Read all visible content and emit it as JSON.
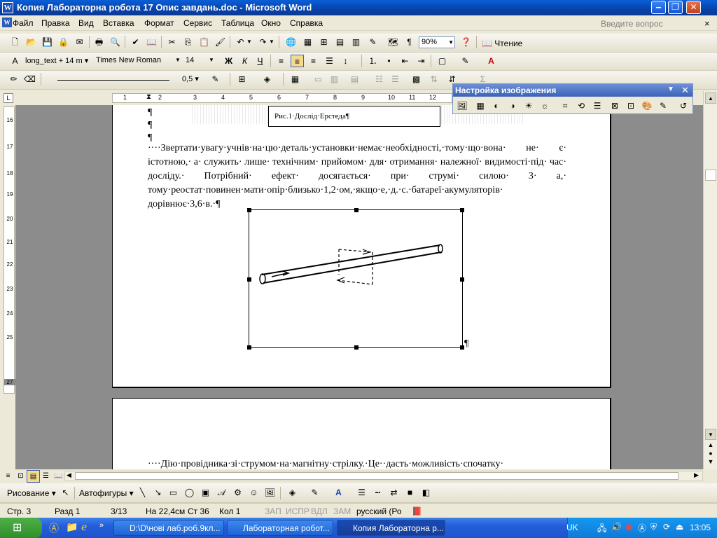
{
  "window": {
    "title": "Копия Лабораторна робота 17 Опис завдань.doc - Microsoft Word",
    "controls": [
      "minimize",
      "restore",
      "close"
    ]
  },
  "menu": {
    "items": [
      "Файл",
      "Правка",
      "Вид",
      "Вставка",
      "Формат",
      "Сервис",
      "Таблица",
      "Окно",
      "Справка"
    ],
    "ask_placeholder": "Введите вопрос"
  },
  "toolbar_standard": {
    "zoom": "90%",
    "reading_label": "Чтение"
  },
  "toolbar_formatting": {
    "style": "long_text + 14 m",
    "font": "Times New Roman",
    "size": "14"
  },
  "toolbar_tables": {
    "line_weight": "0,5"
  },
  "picture_toolbar": {
    "title": "Настройка изображения"
  },
  "document": {
    "caption": "Рис.1·Дослід·Ерстеда¶",
    "pilcrows": [
      "¶",
      "¶",
      "¶"
    ],
    "paragraph1": "····Звертати·увагу·учнів·на·цю·деталь·установки·немає·необхідності,·тому·що·вона· не· є· істотною,· а· служить· лише· технічним· прийомом· для· отримання· належної· видимості·під· час· досліду.· Потрібний· ефект· досягається· при· струмі· силою· 3· а,· тому·реостат·повинен·мати·опір·близько·1,2·ом,·якщо·е,·д.·с.·батареї·акумуляторів· дорівнює·3,6·в.·¶",
    "figure_mark": "¶",
    "page2_text": "····Дію·провідника·зі·струмом·на·магнітну·стрілку.·Це··дасть·можливість·спочатку·"
  },
  "hruler_numbers": [
    "1",
    "2",
    "3",
    "4",
    "5",
    "6",
    "7",
    "8",
    "9",
    "10",
    "11",
    "12"
  ],
  "vruler_numbers": [
    "16",
    "17",
    "18",
    "19",
    "20",
    "21",
    "22",
    "23",
    "24",
    "25",
    "27"
  ],
  "drawing_toolbar": {
    "draw_label": "Рисование",
    "autoshapes_label": "Автофигуры"
  },
  "status": {
    "page": "Стр.  3",
    "section": "Разд  1",
    "pages": "3/13",
    "position": "На 22,4см",
    "line": "Ст  36",
    "column": "Кол  1",
    "rec": "ЗАП",
    "trk": "ИСПР",
    "ext": "ВДЛ",
    "ovr": "ЗАМ",
    "language": "русский (Ро"
  },
  "taskbar": {
    "tasks": [
      "D:\\D\\нові лаб.роб.9кл...",
      "Лабораторная робот...",
      "Копия Лабораторна р..."
    ],
    "language_indicator": "UK",
    "clock": "13:05"
  }
}
